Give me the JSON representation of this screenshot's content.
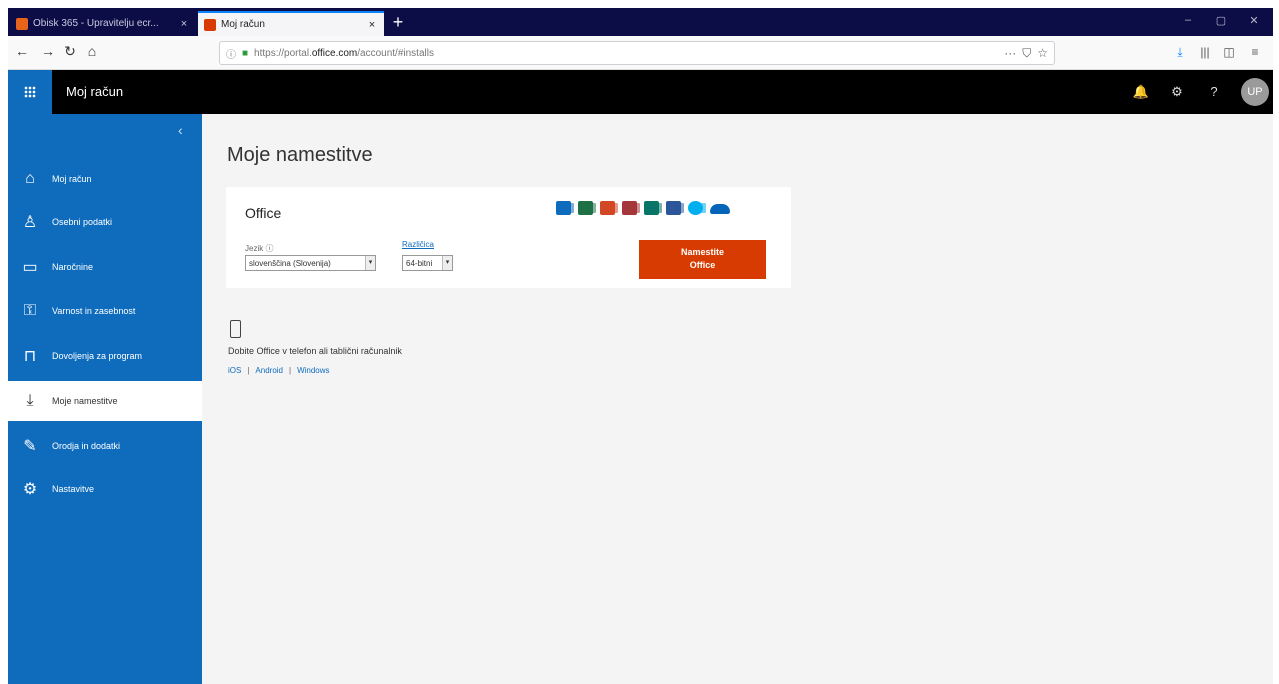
{
  "browser": {
    "tabs": [
      {
        "title": "Obisk 365 - Upravitelju ecr...",
        "active": false
      },
      {
        "title": "Moj račun",
        "active": true
      }
    ],
    "new_tab": "+",
    "tab_close": "×",
    "window_controls": [
      "–",
      "▢",
      "✕"
    ],
    "nav": {
      "back": "←",
      "forward": "→",
      "reload": "↻",
      "home": "⌂"
    },
    "url_prefix": "https://portal.",
    "url_host": "office.com",
    "url_path": "/account/#installs",
    "url_actions": [
      "···",
      "⛉",
      "☆"
    ],
    "toolbar": [
      "⤓",
      "|||",
      "◫",
      "≡"
    ]
  },
  "suite": {
    "title": "Moj račun",
    "icons": [
      "🔔",
      "⚙",
      "?"
    ],
    "avatar": "UP"
  },
  "sidebar": {
    "collapse": "‹",
    "items": [
      {
        "label": "Moj račun",
        "icon": "home-icon",
        "glyph": "⌂"
      },
      {
        "label": "Osebni podatki",
        "icon": "person-icon",
        "glyph": "♙"
      },
      {
        "label": "Naročnine",
        "icon": "card-icon",
        "glyph": "▭"
      },
      {
        "label": "Varnost in zasebnost",
        "icon": "key-icon",
        "glyph": "⚿"
      },
      {
        "label": "Dovoljenja za program",
        "icon": "lock-icon",
        "glyph": "⊓"
      },
      {
        "label": "Moje namestitve",
        "icon": "download-icon",
        "glyph": "⤓"
      },
      {
        "label": "Orodja in dodatki",
        "icon": "wrench-icon",
        "glyph": "✎"
      },
      {
        "label": "Nastavitve",
        "icon": "settings-icon",
        "glyph": "⚙"
      }
    ]
  },
  "main": {
    "title": "Moje namestitve",
    "card": {
      "title": "Office",
      "apps": [
        {
          "icon": "outlook-icon",
          "color": "#0f6cbd"
        },
        {
          "icon": "excel-icon",
          "color": "#1e7145"
        },
        {
          "icon": "powerpoint-icon",
          "color": "#d24726"
        },
        {
          "icon": "access-icon",
          "color": "#a4373a"
        },
        {
          "icon": "publisher-icon",
          "color": "#077568"
        },
        {
          "icon": "word-icon",
          "color": "#2b579a"
        },
        {
          "icon": "skype-icon",
          "color": "#00aff0"
        },
        {
          "icon": "onedrive-icon",
          "color": "#0364b8"
        }
      ],
      "language_label": "Jezik ⓘ",
      "language_value": "slovenščina (Slovenija)",
      "arch_label": "Različica",
      "arch_value": "64-bitni",
      "install_button": [
        "Namestite",
        "Office"
      ]
    },
    "mobile": {
      "text": "Dobite Office v telefon ali tablični računalnik",
      "links": [
        "iOS",
        "Android",
        "Windows"
      ],
      "separator": "|"
    }
  }
}
